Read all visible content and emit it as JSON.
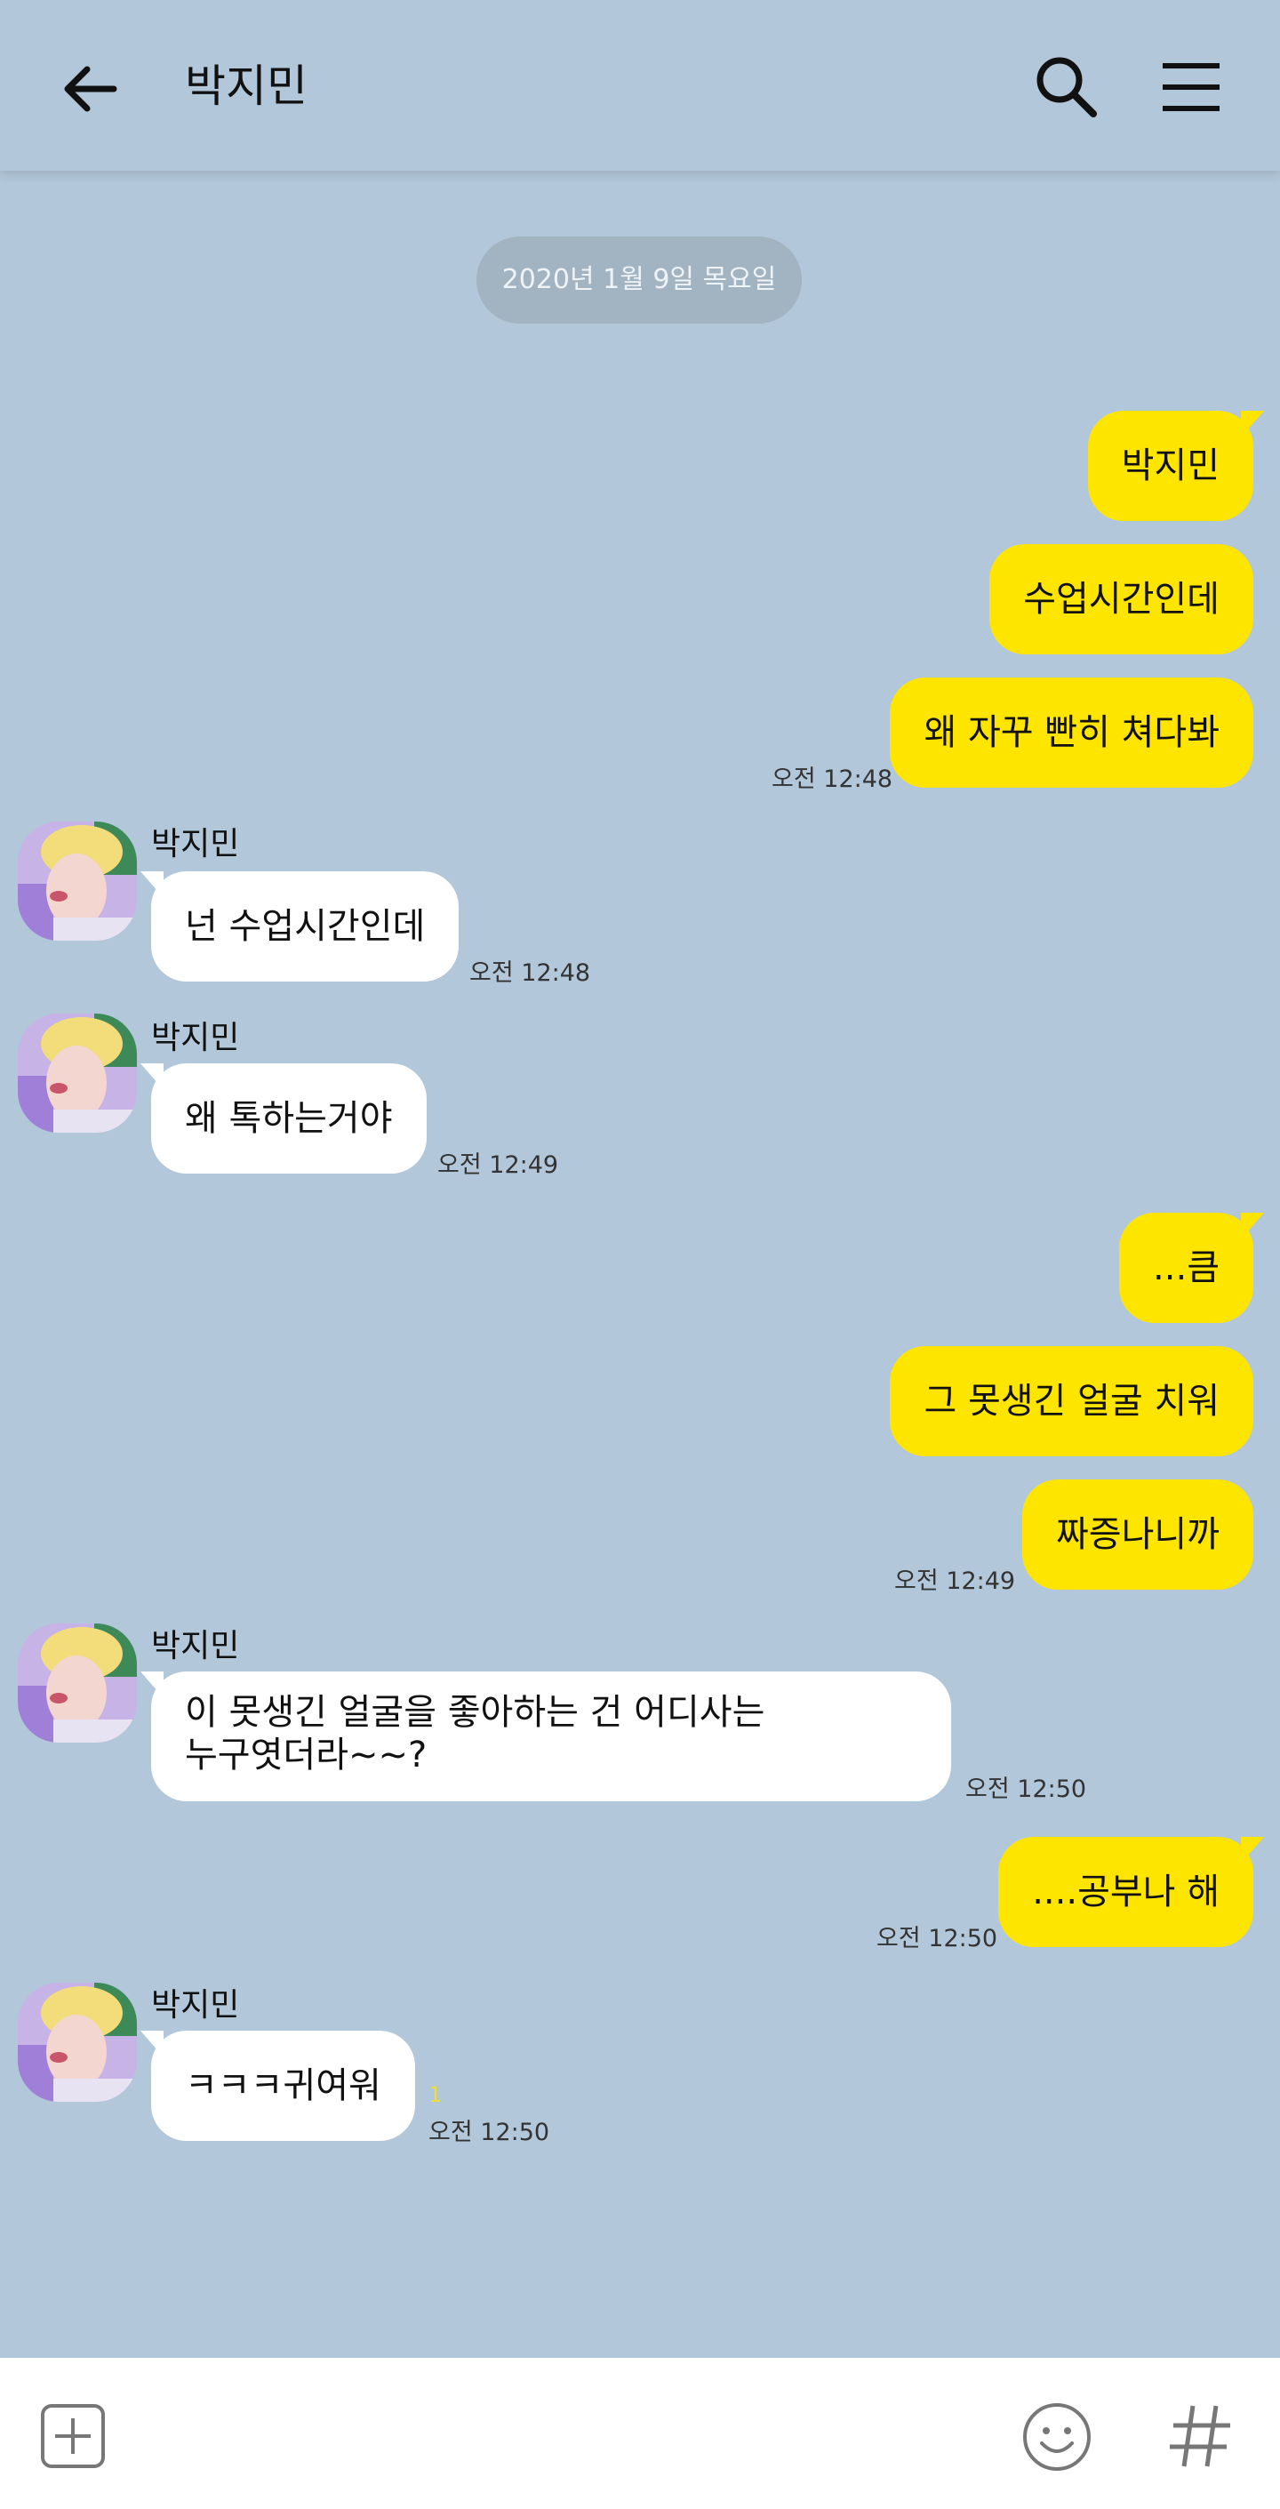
{
  "header": {
    "title": "박지민"
  },
  "date_divider": "2020년 1월 9일 목요일",
  "messages": [
    {
      "dir": "out",
      "text": "박지민"
    },
    {
      "dir": "out",
      "text": "수업시간인데"
    },
    {
      "dir": "out",
      "text": "왜 자꾸 빤히 쳐다봐",
      "time": "오전 12:48"
    },
    {
      "dir": "in",
      "sender": "박지민",
      "text": "넌 수업시간인데",
      "time": "오전 12:48"
    },
    {
      "dir": "in",
      "sender": "박지민",
      "text": "왜 톡하는거야",
      "time": "오전 12:49"
    },
    {
      "dir": "out",
      "text": "...큼"
    },
    {
      "dir": "out",
      "text": "그 못생긴 얼굴 치워"
    },
    {
      "dir": "out",
      "text": "짜증나니까",
      "time": "오전 12:49"
    },
    {
      "dir": "in",
      "sender": "박지민",
      "text_line1": "이 못생긴 얼굴을 좋아하는 건 어디사는",
      "text_line2": "누구엿더라~~?",
      "time": "오전 12:50"
    },
    {
      "dir": "out",
      "text": "....공부나 해",
      "time": "오전 12:50"
    },
    {
      "dir": "in",
      "sender": "박지민",
      "text": "ㅋㅋㅋ귀여워",
      "unread": "1",
      "time": "오전 12:50"
    }
  ],
  "icons": {
    "back": "arrow-left-icon",
    "search": "search-icon",
    "menu": "hamburger-menu-icon",
    "attach": "plus-box-icon",
    "emoji": "emoji-icon",
    "hashtag": "hash-icon"
  },
  "colors": {
    "background": "#b2c7da",
    "outgoing_bubble": "#fee500",
    "incoming_bubble": "#ffffff",
    "unread_count": "#f1dc3a"
  }
}
